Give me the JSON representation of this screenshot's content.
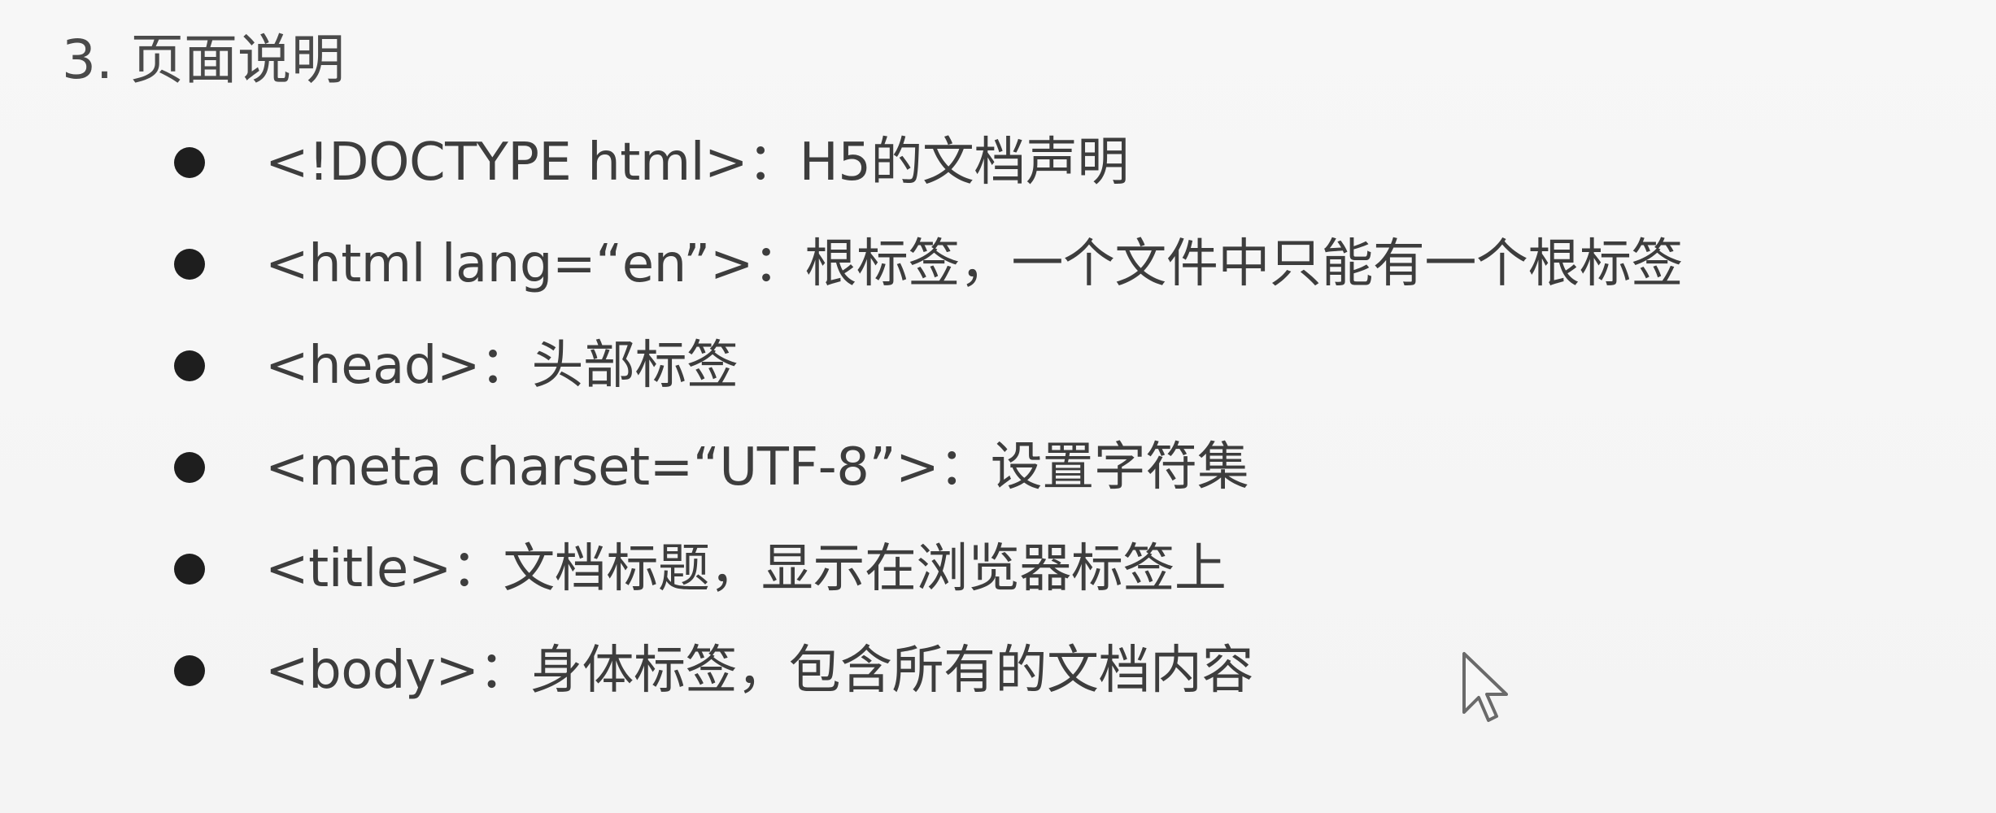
{
  "heading": "3. 页面说明",
  "items": [
    {
      "text": "<!DOCTYPE html>：H5的文档声明"
    },
    {
      "text": "<html lang=“en”>：根标签，一个文件中只能有一个根标签"
    },
    {
      "text": "<head>：头部标签"
    },
    {
      "text": "<meta charset=“UTF-8”>：设置字符集"
    },
    {
      "text": "<title>：文档标题，显示在浏览器标签上"
    },
    {
      "text": "<body>：身体标签，包含所有的文档内容"
    }
  ],
  "icons": {
    "bullet": "bullet-dot-icon",
    "cursor": "mouse-pointer-icon"
  },
  "colors": {
    "background": "#f6f6f6",
    "text": "#3d3d3d",
    "bullet": "#1e1e1e"
  }
}
